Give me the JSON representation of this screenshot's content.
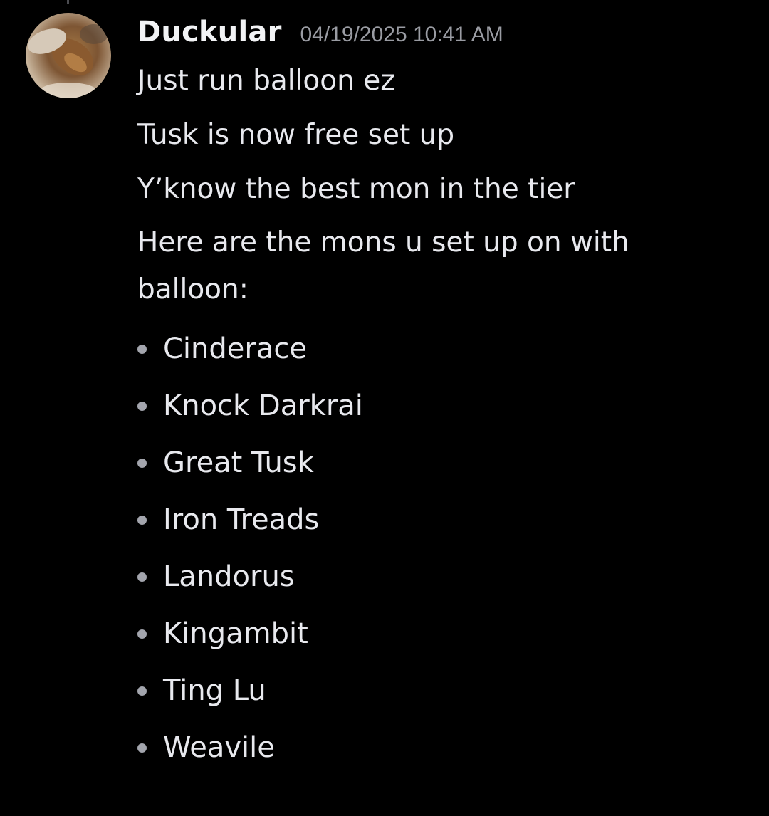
{
  "message": {
    "author": "Duckular",
    "timestamp": "04/19/2025 10:41 AM",
    "avatar_icon": "user-avatar-photo",
    "lines": [
      "Just run balloon ez",
      "Tusk is now free set up",
      "Y’know the best mon in the tier",
      "Here are the mons u set up on with balloon:"
    ],
    "bullets": [
      "Cinderace",
      "Knock Darkrai",
      "Great Tusk",
      "Iron Treads",
      "Landorus",
      "Kingambit",
      "Ting Lu",
      "Weavile"
    ]
  },
  "colors": {
    "background": "#000000",
    "text": "#e8e9ee",
    "username": "#f2f3f5",
    "timestamp": "#9a9ca3",
    "bullet": "#a3a5ad"
  }
}
